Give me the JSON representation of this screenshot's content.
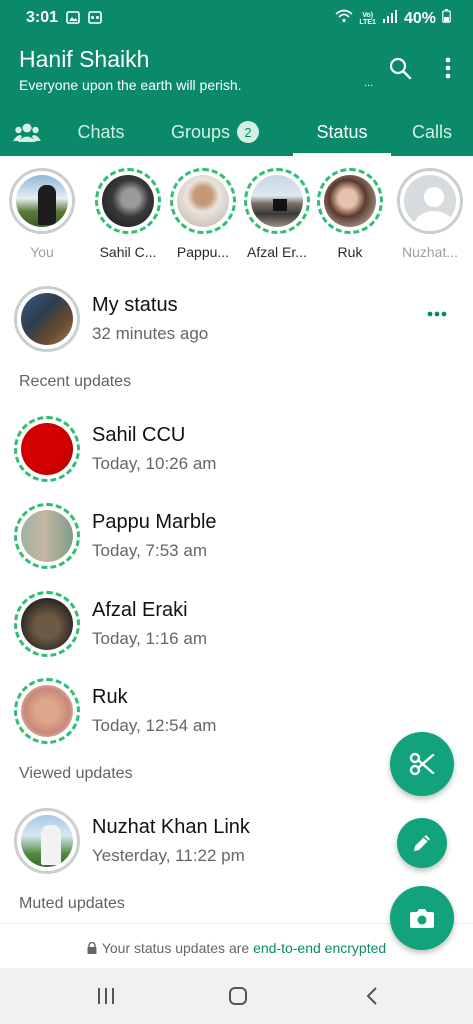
{
  "status_bar": {
    "time": "3:01",
    "battery": "40%",
    "network": "Vo)\nLTE1"
  },
  "header": {
    "title": "Hanif Shaikh",
    "subtitle": "Everyone upon the earth will perish.",
    "ellipsis": "...",
    "icons": [
      "search-icon",
      "more-vertical-icon"
    ]
  },
  "tabs": [
    {
      "label": "Chats"
    },
    {
      "label": "Groups",
      "badge": "2"
    },
    {
      "label": "Status",
      "active": true
    },
    {
      "label": "Calls"
    }
  ],
  "stories": [
    {
      "name": "You"
    },
    {
      "name": "Sahil C..."
    },
    {
      "name": "Pappu..."
    },
    {
      "name": "Afzal Er..."
    },
    {
      "name": "Ruk"
    },
    {
      "name": "Nuzhat..."
    }
  ],
  "my_status": {
    "name": "My status",
    "time": "32 minutes ago"
  },
  "sections": {
    "recent": "Recent updates",
    "viewed": "Viewed updates",
    "muted": "Muted updates"
  },
  "recent": [
    {
      "name": "Sahil CCU",
      "time": "Today, 10:26 am"
    },
    {
      "name": "Pappu Marble",
      "time": "Today, 7:53 am"
    },
    {
      "name": "Afzal Eraki",
      "time": "Today, 1:16 am"
    },
    {
      "name": "Ruk",
      "time": "Today, 12:54 am"
    }
  ],
  "viewed": [
    {
      "name": "Nuzhat Khan Link",
      "time": "Yesterday, 11:22 pm"
    }
  ],
  "footer": {
    "text": "Your status updates are ",
    "link": "end-to-end encrypted"
  },
  "colors": {
    "primary": "#0b8a6a",
    "fab": "#12a37c",
    "unseen_ring": "#2fbf71",
    "seen_ring": "#c9cfcd"
  }
}
